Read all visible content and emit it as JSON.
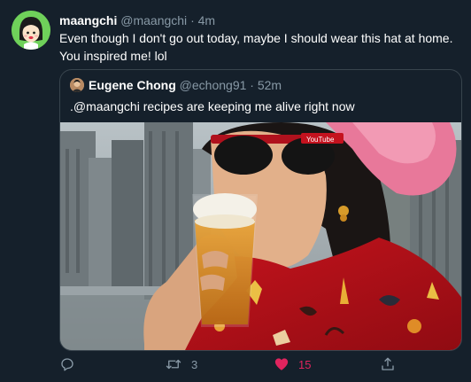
{
  "tweet": {
    "author": {
      "name": "maangchi",
      "handle": "@maangchi",
      "time": "4m"
    },
    "separator": "·",
    "text": "Even though I don't go out today, maybe I should wear this hat at home. You inspired me! lol",
    "quoted": {
      "author": {
        "name": "Eugene Chong",
        "handle": "@echong91",
        "time": "52m"
      },
      "text": ".@maangchi recipes are keeping me alive right now",
      "image": {
        "cap_text": "YouTube"
      }
    },
    "actions": {
      "reply": {
        "icon": "reply-icon",
        "count": ""
      },
      "retweet": {
        "icon": "retweet-icon",
        "count": "3"
      },
      "like": {
        "icon": "heart-icon",
        "count": "15",
        "liked": true
      },
      "share": {
        "icon": "share-icon",
        "count": ""
      }
    }
  },
  "colors": {
    "background": "#15202b",
    "border": "#38444d",
    "muted": "#8899a6",
    "like": "#e0245e",
    "avatar_bg": "#6fd15a"
  }
}
